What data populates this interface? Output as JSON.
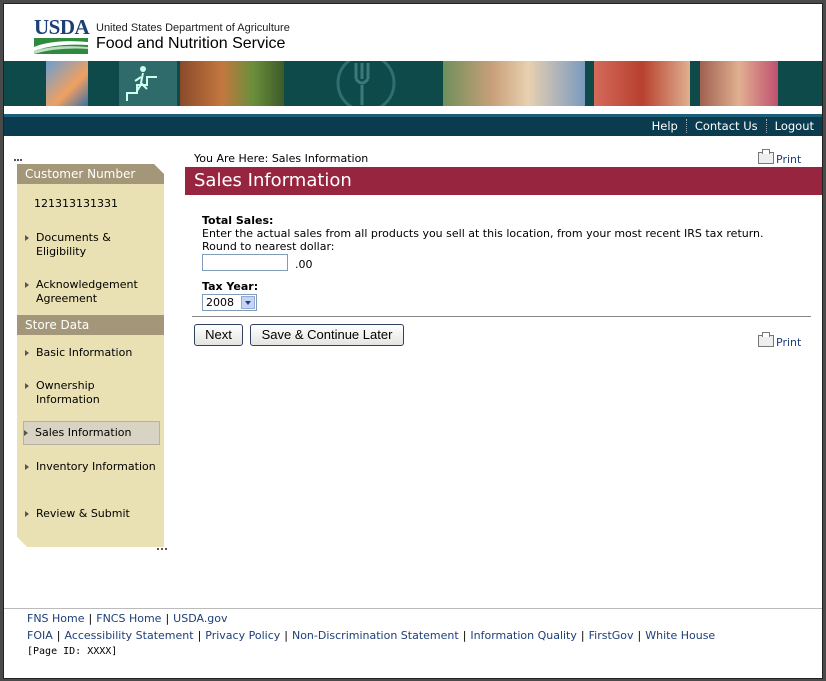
{
  "header": {
    "logo_text": "USDA",
    "dept": "United States Department of Agriculture",
    "agency": "Food and Nutrition Service",
    "brand_color": "#1d3f78",
    "banner_color": "#0e4a4a"
  },
  "nav": {
    "links": [
      "Help",
      "Contact Us",
      "Logout"
    ]
  },
  "sidebar": {
    "customer_header": "Customer Number",
    "customer_number": "121313131331",
    "customer_items": [
      "Documents & Eligibility",
      "Acknowledgement Agreement"
    ],
    "store_header": "Store Data",
    "store_items": [
      "Basic Information",
      "Ownership Information",
      "Sales Information",
      "Inventory Information",
      "Review & Submit"
    ],
    "active_item": "Sales Information"
  },
  "main": {
    "breadcrumb": "You Are Here: Sales Information",
    "print_label": "Print",
    "title": "Sales Information",
    "title_color": "#97253f",
    "total_sales_label": "Total Sales:",
    "total_sales_help_1": "Enter the actual sales from all products you sell at this location, from your most recent IRS tax return.",
    "total_sales_help_2": "Round to nearest dollar:",
    "total_sales_value": "",
    "cents_suffix": ".00",
    "tax_year_label": "Tax Year:",
    "tax_year_value": "2008",
    "next_label": "Next",
    "save_label": "Save & Continue Later"
  },
  "footer": {
    "row1": [
      "FNS Home",
      "FNCS Home",
      "USDA.gov"
    ],
    "row2": [
      "FOIA",
      "Accessibility Statement",
      "Privacy Policy",
      "Non-Discrimination Statement",
      "Information Quality",
      "FirstGov",
      "White House"
    ],
    "page_id": "[Page ID: XXXX]"
  }
}
